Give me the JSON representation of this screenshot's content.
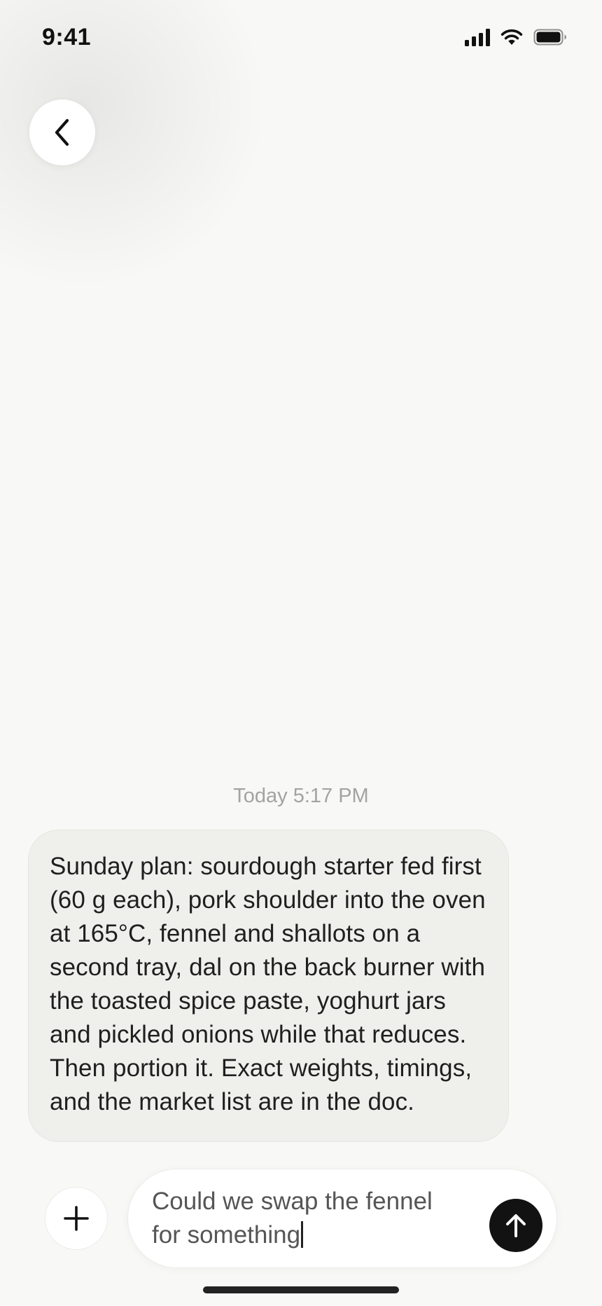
{
  "status_bar": {
    "time": "9:41",
    "icons": [
      "signal-icon",
      "wifi-icon",
      "battery-icon"
    ]
  },
  "navigation": {
    "back_icon": "chevron-left-icon"
  },
  "conversation": {
    "timestamp": "Today 5:17 PM",
    "messages": [
      {
        "text": "Sunday plan: sourdough starter fed first (60 g each), pork shoulder into the oven at 165°C, fennel and shallots on a second tray, dal on the back burner with the toasted spice paste, yoghurt jars and pickled onions while that reduces. Then portion it. Exact weights, timings, and the market list are in the doc."
      }
    ]
  },
  "composer": {
    "add_icon": "plus-icon",
    "draft": "Could we swap the fennel for something",
    "send_icon": "arrow-up-icon"
  },
  "colors": {
    "background": "#f8f8f6",
    "bubble": "#efefeb",
    "send_button": "#121212",
    "timestamp": "#a3a3a3"
  }
}
